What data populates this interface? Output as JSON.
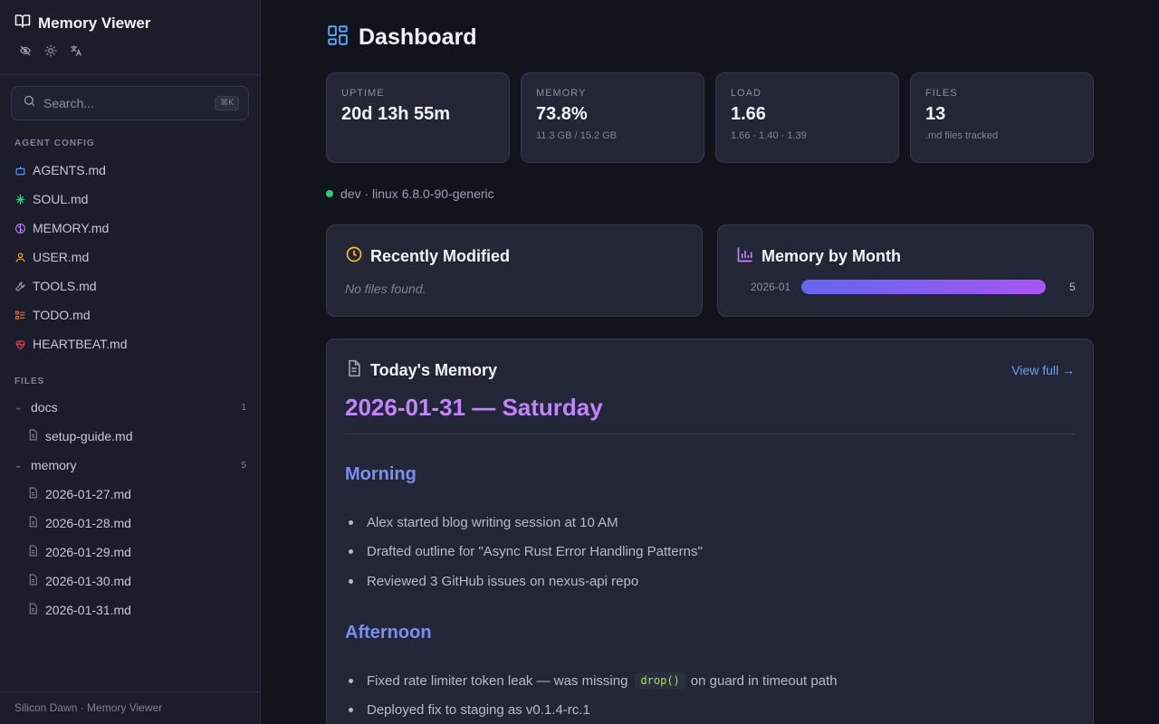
{
  "app": {
    "title": "Memory Viewer"
  },
  "sidebar": {
    "search_placeholder": "Search...",
    "search_shortcut": "⌘K",
    "agent_config_label": "AGENT CONFIG",
    "agent_config": [
      {
        "label": "AGENTS.md",
        "icon": "robot-icon",
        "color": "#60a5fa"
      },
      {
        "label": "SOUL.md",
        "icon": "sparkle-icon",
        "color": "#34d399"
      },
      {
        "label": "MEMORY.md",
        "icon": "brain-icon",
        "color": "#c084fc"
      },
      {
        "label": "USER.md",
        "icon": "user-icon",
        "color": "#fbbf24"
      },
      {
        "label": "TOOLS.md",
        "icon": "wrench-icon",
        "color": "#9aa0b5"
      },
      {
        "label": "TODO.md",
        "icon": "checklist-icon",
        "color": "#f97316"
      },
      {
        "label": "HEARTBEAT.md",
        "icon": "heart-pulse-icon",
        "color": "#f43f5e"
      }
    ],
    "files_label": "FILES",
    "folders": [
      {
        "name": "docs",
        "count": "1",
        "files": [
          "setup-guide.md"
        ]
      },
      {
        "name": "memory",
        "count": "5",
        "files": [
          "2026-01-27.md",
          "2026-01-28.md",
          "2026-01-29.md",
          "2026-01-30.md",
          "2026-01-31.md"
        ]
      }
    ],
    "footer": "Silicon Dawn · Memory Viewer"
  },
  "main": {
    "title": "Dashboard",
    "stats": [
      {
        "label": "UPTIME",
        "value": "20d 13h 55m",
        "sub": ""
      },
      {
        "label": "MEMORY",
        "value": "73.8%",
        "sub": "11.3 GB / 15.2 GB"
      },
      {
        "label": "LOAD",
        "value": "1.66",
        "sub": "1.66 · 1.40 · 1.39"
      },
      {
        "label": "FILES",
        "value": "13",
        "sub": ".md files tracked"
      }
    ],
    "host": "dev · linux 6.8.0-90-generic",
    "status_color": "#2ecc71",
    "recent": {
      "title": "Recently Modified",
      "empty": "No files found."
    },
    "by_month": {
      "title": "Memory by Month",
      "rows": [
        {
          "month": "2026-01",
          "count": 5,
          "fill_fraction": 1.0
        }
      ]
    },
    "today": {
      "title": "Today's Memory",
      "view_full": "View full →",
      "heading": "2026-01-31 — Saturday",
      "sections": [
        {
          "heading": "Morning",
          "items": [
            "Alex started blog writing session at 10 AM",
            "Drafted outline for \"Async Rust Error Handling Patterns\"",
            "Reviewed 3 GitHub issues on nexus-api repo"
          ]
        },
        {
          "heading": "Afternoon",
          "item_1_before": "Fixed rate limiter token leak — was missing",
          "item_1_code": "drop()",
          "item_1_after": "on guard in timeout path",
          "item_2": "Deployed fix to staging as v0.1.4-rc.1"
        }
      ]
    }
  }
}
